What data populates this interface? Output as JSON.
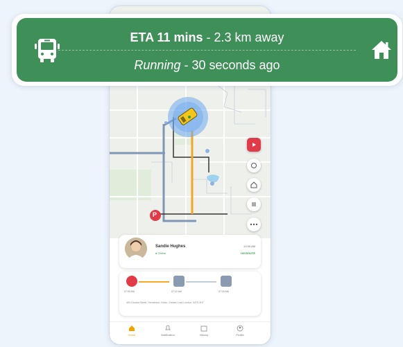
{
  "eta_banner": {
    "eta": "ETA 11 mins",
    "separator": " - ",
    "distance": "2.3 km away",
    "status": "Running",
    "updated": "30 seconds ago",
    "left_icon": "bus-icon",
    "right_icon": "home-icon"
  },
  "map": {
    "marker_label": "P",
    "controls": [
      "youtube-icon",
      "compass-icon",
      "home-icon",
      "layers-icon",
      "more-icon"
    ]
  },
  "driver": {
    "name": "Sandie Hughes",
    "status": "● Online",
    "time": "12:00 AM",
    "state": "ON ROUTE"
  },
  "trip": {
    "stops": [
      {
        "time": "07:00 AM",
        "icon": "pickup-pin-icon"
      },
      {
        "time": "07:12 AM",
        "icon": "school-icon"
      },
      {
        "time": "07:18 AM",
        "icon": "dropoff-icon"
      }
    ],
    "address": "4514 Acacia Street, Henderson, Kelso, Greater Lusk London, 04TS 3HT"
  },
  "nav": {
    "items": [
      {
        "label": "Home"
      },
      {
        "label": "Notification"
      },
      {
        "label": "History"
      },
      {
        "label": "Profile"
      }
    ]
  },
  "colors": {
    "banner_green": "#3f8f59",
    "route_orange": "#f5a623",
    "accent_red": "#e23a46",
    "nav_active": "#f0a400"
  }
}
